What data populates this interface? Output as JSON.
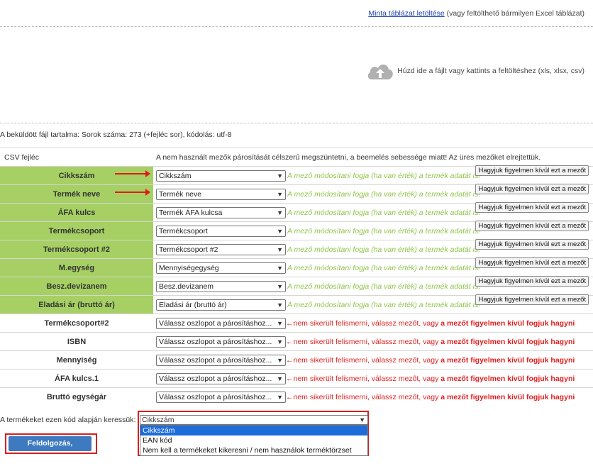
{
  "top": {
    "link_text": "Minta táblázat letöltése",
    "link_suffix": " (vagy feltölthető bármilyen Excel táblázat)"
  },
  "dropzone": {
    "text": "Húzd ide a fájlt vagy kattints a feltöltéshez (xls, xlsx, csv)",
    "icon": "cloud-upload-icon"
  },
  "file_info": "A beküldött fájl tartalma: Sorok száma: 273 (+fejléc sor), kódolás: utf-8",
  "table": {
    "header_left": "CSV fejléc",
    "header_right": "A nem használt mezők párosítását célszerű megszüntetni, a beemelés sebessége miatt! Az üres mezőket elrejtettük.",
    "matched_hint": "A mező módosítani fogja (ha van érték) a termék adatát is!",
    "ignore_label": "Hagyjuk figyelmen kívül ezt a mezőt",
    "unmatched_placeholder": "Válassz oszlopot a párosításhoz...",
    "unmatched_msg_prefix": "←nem sikerült felismerni, válassz mezőt, vagy ",
    "unmatched_msg_bold": "a mezőt figyelmen kívül fogjuk hagyni",
    "matched_rows": [
      {
        "label": "Cikkszám",
        "value": "Cikkszám"
      },
      {
        "label": "Termék neve",
        "value": "Termék neve"
      },
      {
        "label": "ÁFA kulcs",
        "value": "Termék ÁFA kulcsa"
      },
      {
        "label": "Termékcsoport",
        "value": "Termékcsoport"
      },
      {
        "label": "Termékcsoport #2",
        "value": "Termékcsoport #2"
      },
      {
        "label": "M.egység",
        "value": "Mennyiségegység"
      },
      {
        "label": "Besz.devizanem",
        "value": "Besz.devizanem"
      },
      {
        "label": "Eladási ár (bruttó ár)",
        "value": "Eladási ár (bruttó ár)"
      }
    ],
    "unmatched_rows": [
      {
        "label": "Termékcsoport#2"
      },
      {
        "label": "ISBN"
      },
      {
        "label": "Mennyiség"
      },
      {
        "label": "ÁFA kulcs.1"
      },
      {
        "label": "Bruttó egységár"
      }
    ]
  },
  "search": {
    "label": "A termékeket ezen kód alapján keressük:",
    "selected": "Cikkszám",
    "options": [
      "Cikkszám",
      "EAN kód",
      "Nem kell a termékeket kikeresni / nem használok terméktörzset"
    ]
  },
  "process_button": "Feldolgozás, ellenőrzés",
  "colors": {
    "matched_bg": "#a6d063",
    "hint": "#8fc44a",
    "error": "#e02020",
    "button": "#3d7ac0",
    "highlight_border": "#d62020"
  }
}
